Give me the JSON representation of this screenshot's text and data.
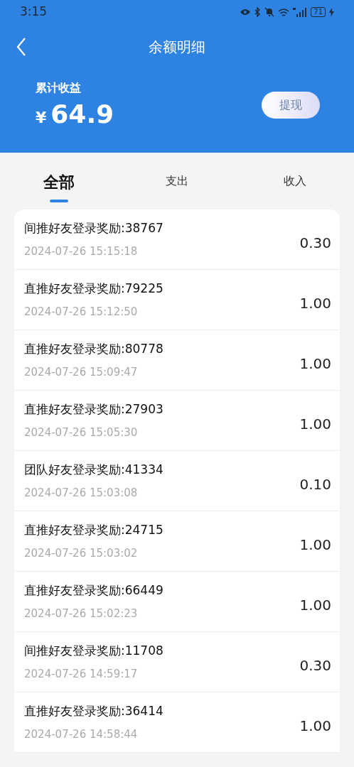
{
  "status_bar": {
    "time": "3:15",
    "battery": "71"
  },
  "header": {
    "title": "余额明细"
  },
  "summary": {
    "label": "累计收益",
    "currency": "¥",
    "amount": "64.9",
    "button": "提现"
  },
  "tabs": [
    {
      "label": "全部",
      "selected": true
    },
    {
      "label": "支出",
      "selected": false
    },
    {
      "label": "收入",
      "selected": false
    }
  ],
  "records": [
    {
      "title": "间推好友登录奖励:38767",
      "time": "2024-07-26 15:15:18",
      "amount": "0.30"
    },
    {
      "title": "直推好友登录奖励:79225",
      "time": "2024-07-26 15:12:50",
      "amount": "1.00"
    },
    {
      "title": "直推好友登录奖励:80778",
      "time": "2024-07-26 15:09:47",
      "amount": "1.00"
    },
    {
      "title": "直推好友登录奖励:27903",
      "time": "2024-07-26 15:05:30",
      "amount": "1.00"
    },
    {
      "title": "团队好友登录奖励:41334",
      "time": "2024-07-26 15:03:08",
      "amount": "0.10"
    },
    {
      "title": "直推好友登录奖励:24715",
      "time": "2024-07-26 15:03:02",
      "amount": "1.00"
    },
    {
      "title": "直推好友登录奖励:66449",
      "time": "2024-07-26 15:02:23",
      "amount": "1.00"
    },
    {
      "title": "间推好友登录奖励:11708",
      "time": "2024-07-26 14:59:17",
      "amount": "0.30"
    },
    {
      "title": "直推好友登录奖励:36414",
      "time": "2024-07-26 14:58:44",
      "amount": "1.00"
    }
  ]
}
